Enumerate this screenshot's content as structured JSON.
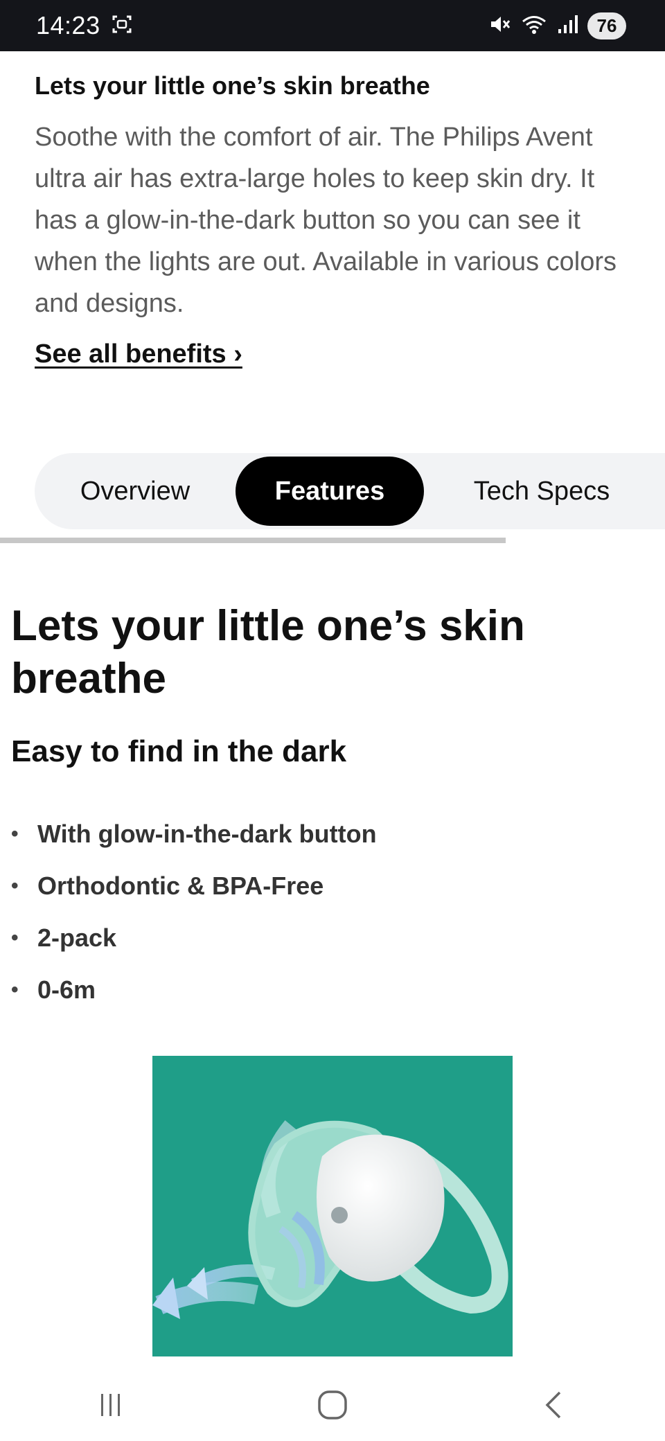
{
  "status_bar": {
    "time": "14:23",
    "battery": "76",
    "icons": [
      "screenshot-icon",
      "mute-icon",
      "wifi-icon",
      "signal-icon"
    ]
  },
  "summary": {
    "title": "Lets your little one’s skin breathe",
    "body": "Soothe with the comfort of air. The Philips Avent ultra air has extra-large holes to keep skin dry. It has a glow-in-the-dark button so you can see it when the lights are out. Available in various colors and designs.",
    "link": "See all benefits ›"
  },
  "tabs": [
    {
      "label": "Overview",
      "active": false
    },
    {
      "label": "Features",
      "active": true
    },
    {
      "label": "Tech Specs",
      "active": false
    }
  ],
  "feature": {
    "title": "Lets your little one’s skin breathe",
    "subtitle": "Easy to find in the dark",
    "bullets": [
      "With glow-in-the-dark button",
      "Orthodontic & BPA-Free",
      "2-pack",
      "0-6m"
    ]
  },
  "product_image": {
    "subject": "pacifier",
    "background_color": "#1f9e88"
  },
  "nav_bar": {
    "icons": [
      "recent-apps-icon",
      "home-icon",
      "back-icon"
    ]
  }
}
